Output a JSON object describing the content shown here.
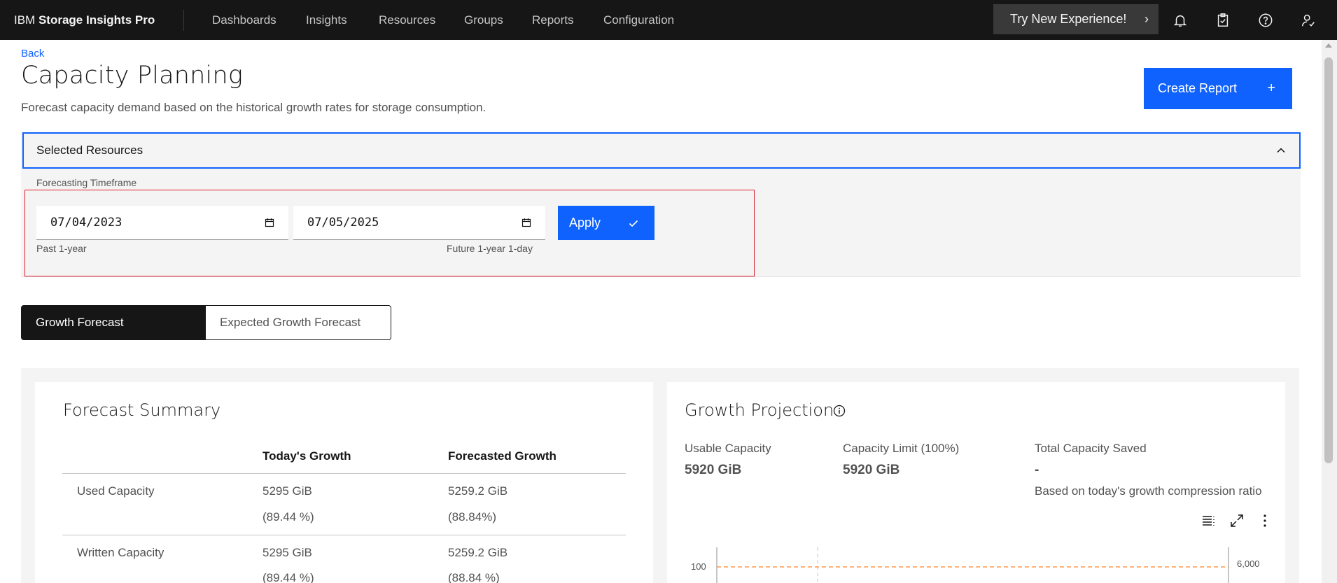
{
  "nav": {
    "brand_prefix": "IBM",
    "brand_name": "Storage Insights Pro",
    "items": [
      "Dashboards",
      "Insights",
      "Resources",
      "Groups",
      "Reports",
      "Configuration"
    ],
    "try_new": "Try New Experience!",
    "icons": [
      "notification-icon",
      "clipboard-icon",
      "help-icon",
      "user-icon"
    ]
  },
  "header": {
    "back": "Back",
    "title": "Capacity Planning",
    "description": "Forecast capacity demand based on the historical growth rates for storage consumption.",
    "create_report": "Create Report"
  },
  "resources": {
    "accordion_title": "Selected Resources",
    "timeframe_label": "Forecasting Timeframe",
    "start_date": "07/04/2023",
    "end_date": "07/05/2025",
    "start_helper": "Past 1-year",
    "end_helper": "Future 1-year 1-day",
    "apply": "Apply"
  },
  "tabs": {
    "active": "Growth Forecast",
    "inactive": "Expected Growth Forecast"
  },
  "forecast_summary": {
    "title": "Forecast Summary",
    "col_today": "Today's Growth",
    "col_forecast": "Forecasted Growth",
    "rows": [
      {
        "label": "Used Capacity",
        "today_value": "5295 GiB",
        "today_pct": "(89.44 %)",
        "forecast_value": "5259.2 GiB",
        "forecast_pct": "(88.84%)"
      },
      {
        "label": "Written Capacity",
        "today_value": "5295 GiB",
        "today_pct": "(89.44 %)",
        "forecast_value": "5259.2 GiB",
        "forecast_pct": "(88.84 %)"
      }
    ]
  },
  "growth_projection": {
    "title": "Growth Projection",
    "usable_label": "Usable Capacity",
    "usable_value": "5920 GiB",
    "limit_label": "Capacity Limit (100%)",
    "limit_value": "5920 GiB",
    "saved_label": "Total Capacity Saved",
    "saved_value": "-",
    "saved_note": "Based on today's growth compression ratio",
    "axis_left_tick": "100",
    "axis_right_tick": "6,000",
    "limit_line_color": "#ff832b"
  }
}
